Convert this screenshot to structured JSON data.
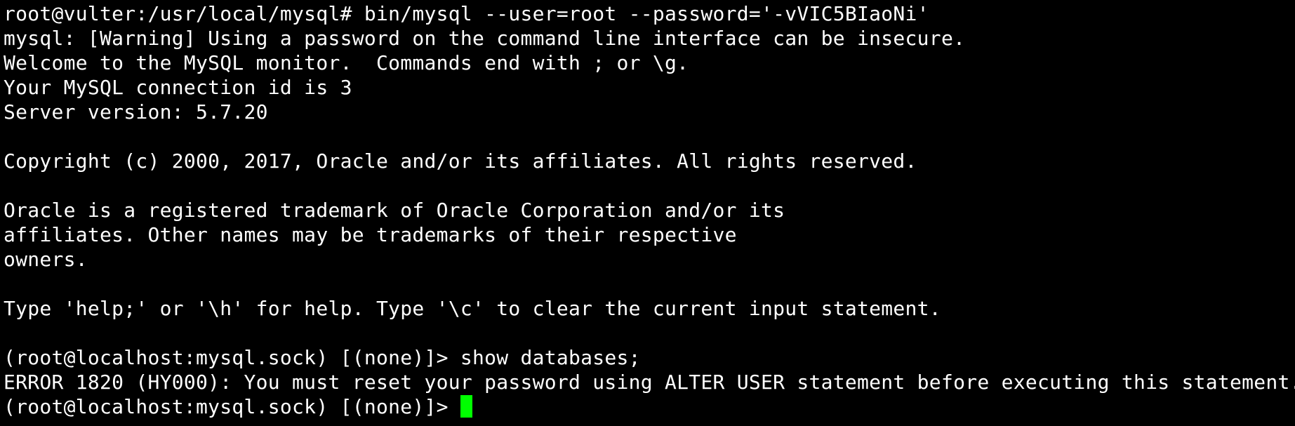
{
  "terminal": {
    "lines": [
      "root@vulter:/usr/local/mysql# bin/mysql --user=root --password='-vVIC5BIaoNi'",
      "mysql: [Warning] Using a password on the command line interface can be insecure.",
      "Welcome to the MySQL monitor.  Commands end with ; or \\g.",
      "Your MySQL connection id is 3",
      "Server version: 5.7.20",
      "",
      "Copyright (c) 2000, 2017, Oracle and/or its affiliates. All rights reserved.",
      "",
      "Oracle is a registered trademark of Oracle Corporation and/or its",
      "affiliates. Other names may be trademarks of their respective",
      "owners.",
      "",
      "Type 'help;' or '\\h' for help. Type '\\c' to clear the current input statement.",
      "",
      "(root@localhost:mysql.sock) [(none)]> show databases;",
      "ERROR 1820 (HY000): You must reset your password using ALTER USER statement before executing this statement."
    ],
    "prompt": "(root@localhost:mysql.sock) [(none)]> ",
    "cursor_color": "#00ff00",
    "background_color": "#000000",
    "text_color": "#ffffff"
  }
}
